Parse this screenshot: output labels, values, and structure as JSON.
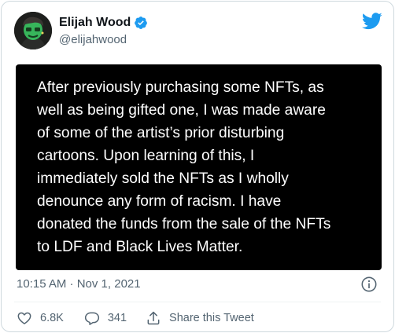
{
  "author": {
    "name": "Elijah Wood",
    "handle": "@elijahwood"
  },
  "media_text_lines": [
    "After previously purchasing some NFTs, as",
    "well as being gifted one, I was made aware",
    "of some of the artist’s prior disturbing",
    "cartoons. Upon learning of this, I",
    "immediately sold the NFTs as I wholly",
    "denounce any form of racism. I have",
    "donated the funds from the sale of the NFTs",
    "to LDF and Black Lives Matter."
  ],
  "timestamp": "10:15 AM · Nov 1, 2021",
  "actions": {
    "like_count": "6.8K",
    "reply_count": "341",
    "share_label": "Share this Tweet"
  },
  "icons": {
    "verified": "verified-badge-icon",
    "brand": "twitter-bird-icon",
    "info": "info-icon",
    "like": "heart-icon",
    "reply": "speech-bubble-icon",
    "share": "share-icon"
  },
  "colors": {
    "brand_blue": "#1d9bf0",
    "text_primary": "#0f1419",
    "text_secondary": "#536471",
    "border": "#cfd9de",
    "media_bg": "#000000"
  }
}
